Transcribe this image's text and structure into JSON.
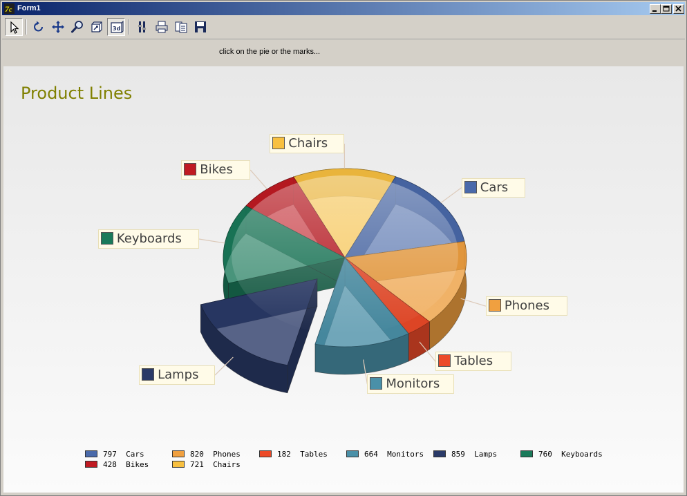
{
  "window": {
    "title": "Form1"
  },
  "toolbar": {
    "buttons": [
      {
        "name": "pointer-icon",
        "pressed": true
      },
      {
        "name": "rotate-icon"
      },
      {
        "name": "move-icon"
      },
      {
        "name": "zoom-icon"
      },
      {
        "name": "depth-icon"
      },
      {
        "name": "3d-view-icon",
        "pressed": true
      },
      {
        "name": "edit-tools-icon"
      },
      {
        "name": "print-icon"
      },
      {
        "name": "copy-icon"
      },
      {
        "name": "save-icon"
      }
    ]
  },
  "status": {
    "text": "click on the pie or the marks..."
  },
  "chart_data": {
    "type": "pie",
    "title": "Product Lines",
    "slices": [
      {
        "label": "Cars",
        "value": 797,
        "color": "#4a6aaa"
      },
      {
        "label": "Phones",
        "value": 820,
        "color": "#f0a040"
      },
      {
        "label": "Tables",
        "value": 182,
        "color": "#ec4a28"
      },
      {
        "label": "Monitors",
        "value": 664,
        "color": "#4a90a8"
      },
      {
        "label": "Lamps",
        "value": 859,
        "color": "#2a3a68",
        "exploded": true
      },
      {
        "label": "Keyboards",
        "value": 760,
        "color": "#1a7a5a"
      },
      {
        "label": "Bikes",
        "value": 428,
        "color": "#c01a22"
      },
      {
        "label": "Chairs",
        "value": 721,
        "color": "#f8c040"
      }
    ],
    "legend_position": "bottom"
  }
}
